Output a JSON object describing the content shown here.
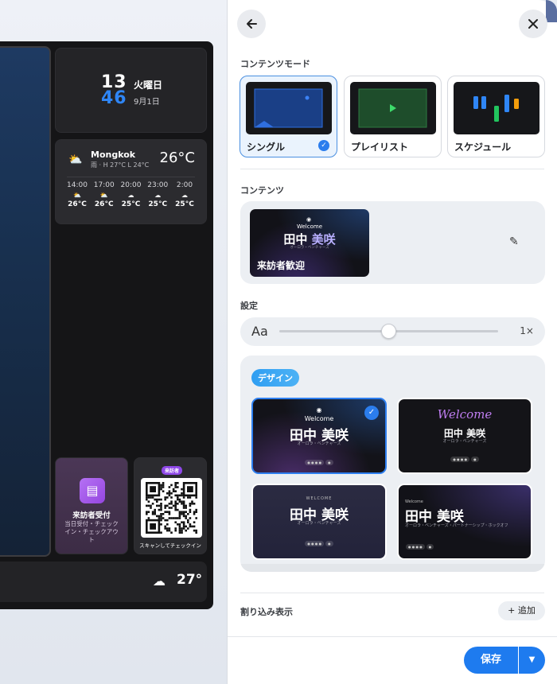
{
  "preview": {
    "clock": {
      "hours": "13",
      "minutes": "46",
      "weekday": "火曜日",
      "date": "9月1日"
    },
    "weather": {
      "city": "Mongkok",
      "description": "雨 · H 27°C L 24°C",
      "temperature": "26°C",
      "hourly": [
        {
          "time": "14:00",
          "icon": "partly-cloudy-icon",
          "temp": "26°C"
        },
        {
          "time": "17:00",
          "icon": "partly-cloudy-icon",
          "temp": "26°C"
        },
        {
          "time": "20:00",
          "icon": "cloud-icon",
          "temp": "25°C"
        },
        {
          "time": "23:00",
          "icon": "cloud-icon",
          "temp": "25°C"
        },
        {
          "time": "2:00",
          "icon": "cloud-icon",
          "temp": "25°C"
        }
      ]
    },
    "visitor": {
      "title": "来訪者受付",
      "subtitle": "当日受付・チェックイン・チェックアウト"
    },
    "qr": {
      "badge": "来訪者",
      "caption": "スキャンしてチェックイン"
    },
    "bottom_weather": {
      "icon": "cloud-icon",
      "temp": "27°"
    }
  },
  "panel": {
    "back_icon": "back-arrow-icon",
    "close_icon": "close-icon",
    "content_mode_label": "コンテンツモード",
    "modes": [
      {
        "label": "シングル",
        "selected": true
      },
      {
        "label": "プレイリスト",
        "selected": false
      },
      {
        "label": "スケジュール",
        "selected": false
      }
    ],
    "content_label": "コンテンツ",
    "content_item": {
      "welcome": "Welcome",
      "name_first": "田中",
      "name_last": "美咲",
      "company": "オーロラ・ベンチャーズ",
      "label": "来訪者歓迎"
    },
    "settings_label": "設定",
    "font_size": {
      "icon_text": "Aa",
      "value_label": "1×",
      "value": 0.5
    },
    "design_label": "デザイン",
    "design_cards": [
      {
        "welcome": "Welcome",
        "name": "田中 美咲",
        "sub": "オーロラ・ベンチャーズ",
        "selected": true
      },
      {
        "welcome": "Welcome",
        "name": "田中 美咲",
        "sub": "オーロラ・ベンチャーズ",
        "selected": false
      },
      {
        "welcome": "WELCOME",
        "name": "田中 美咲",
        "sub": "オーロラ・ベンチャーズ",
        "selected": false
      },
      {
        "welcome": "Welcome",
        "name": "田中 美咲",
        "sub": "オーロラ・ベンチャーズ・パートナーシップ・ホックオフ",
        "selected": false
      }
    ],
    "interrupt_label": "割り込み表示",
    "add_label": "追加",
    "save_label": "保存"
  },
  "colors": {
    "accent": "#1e7bef",
    "mode_selected_bg": "#eaf3fd",
    "badge": "#2f9ef2"
  }
}
